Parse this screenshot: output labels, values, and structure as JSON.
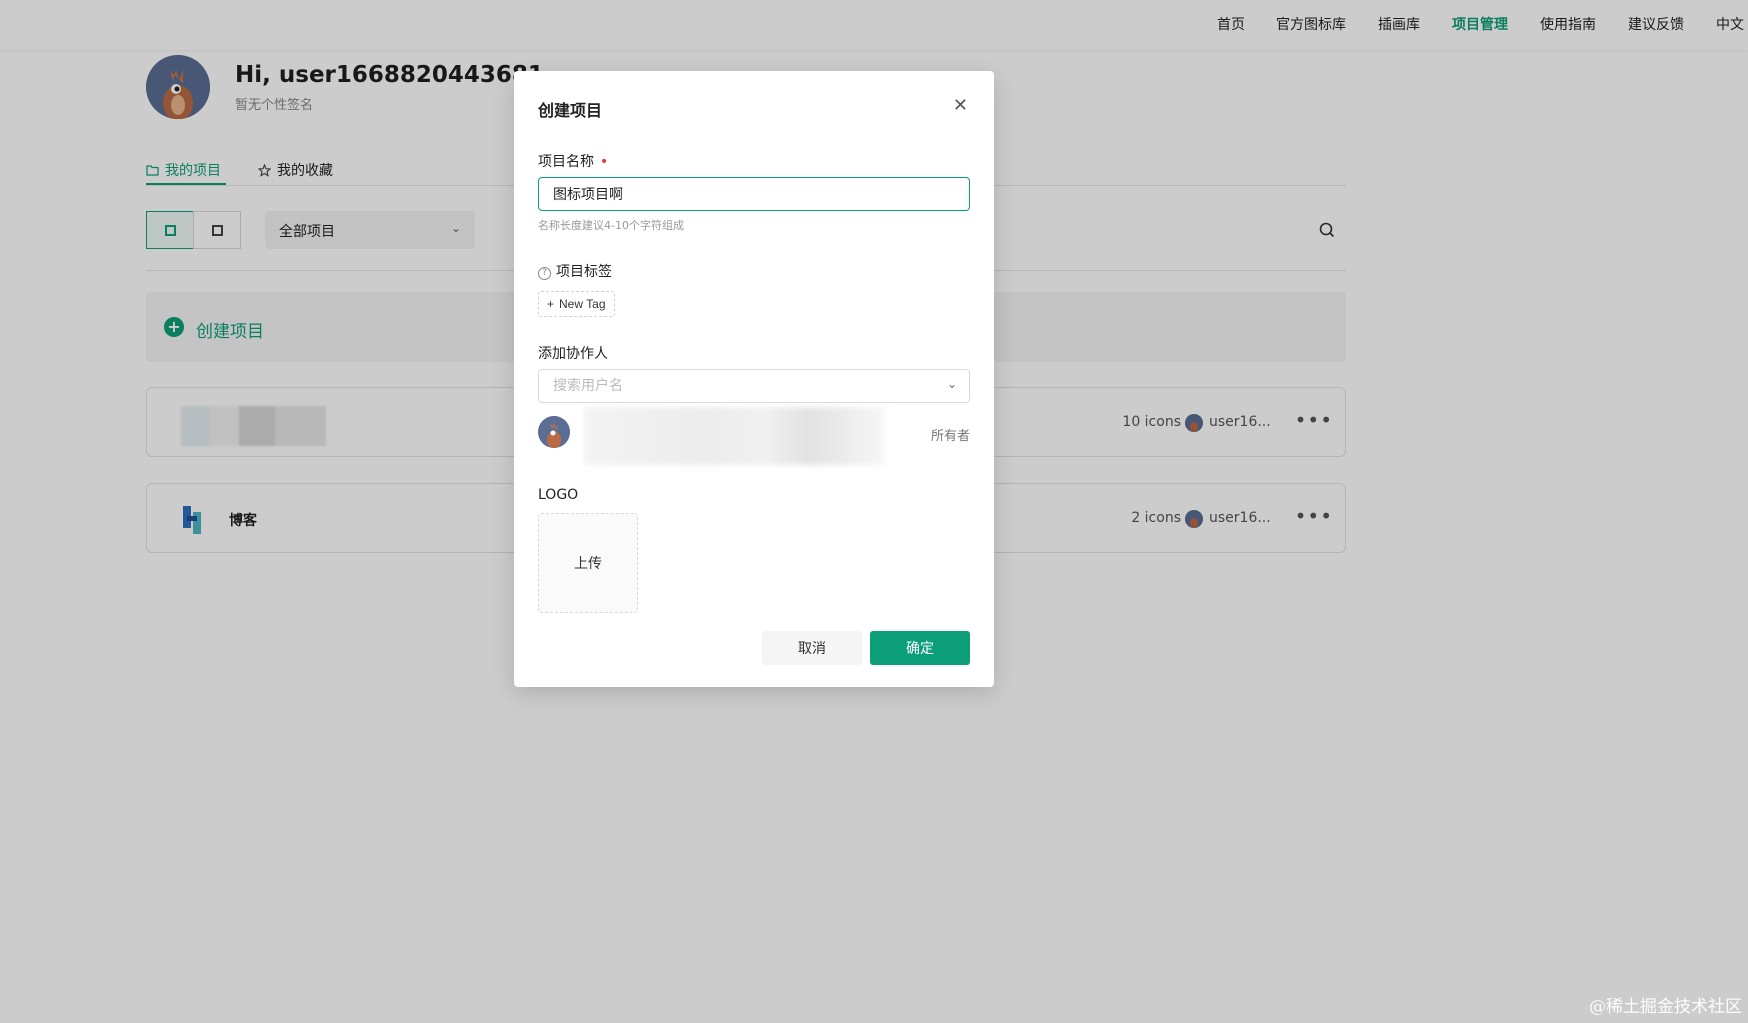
{
  "nav": {
    "items": [
      {
        "label": "首页",
        "active": false
      },
      {
        "label": "官方图标库",
        "active": false
      },
      {
        "label": "插画库",
        "active": false
      },
      {
        "label": "项目管理",
        "active": true
      },
      {
        "label": "使用指南",
        "active": false
      },
      {
        "label": "建议反馈",
        "active": false
      },
      {
        "label": "中文",
        "active": false
      }
    ]
  },
  "profile": {
    "greeting": "Hi, user1668820443681",
    "signature": "暂无个性签名"
  },
  "tabs": [
    {
      "label": "我的项目",
      "icon": "folder-icon",
      "active": true
    },
    {
      "label": "我的收藏",
      "icon": "star-icon",
      "active": false
    }
  ],
  "toolbar": {
    "filter_value": "全部项目"
  },
  "create_strip": {
    "label": "创建项目"
  },
  "projects": [
    {
      "name": "",
      "count": "10 icons",
      "owner": "user16..."
    },
    {
      "name": "博客",
      "count": "2 icons",
      "owner": "user16..."
    }
  ],
  "modal": {
    "title": "创建项目",
    "name_label": "项目名称",
    "name_required": "•",
    "name_value": "图标项目啊",
    "name_hint": "名称长度建议4-10个字符组成",
    "tags_label": "项目标签",
    "new_tag_label": "New Tag",
    "collab_label": "添加协作人",
    "collab_placeholder": "搜索用户名",
    "owner_role": "所有者",
    "logo_label": "LOGO",
    "upload_label": "上传",
    "cancel_label": "取消",
    "ok_label": "确定"
  },
  "watermark": "@稀土掘金技术社区",
  "colors": {
    "accent": "#0c9e78",
    "required": "#e53935"
  }
}
